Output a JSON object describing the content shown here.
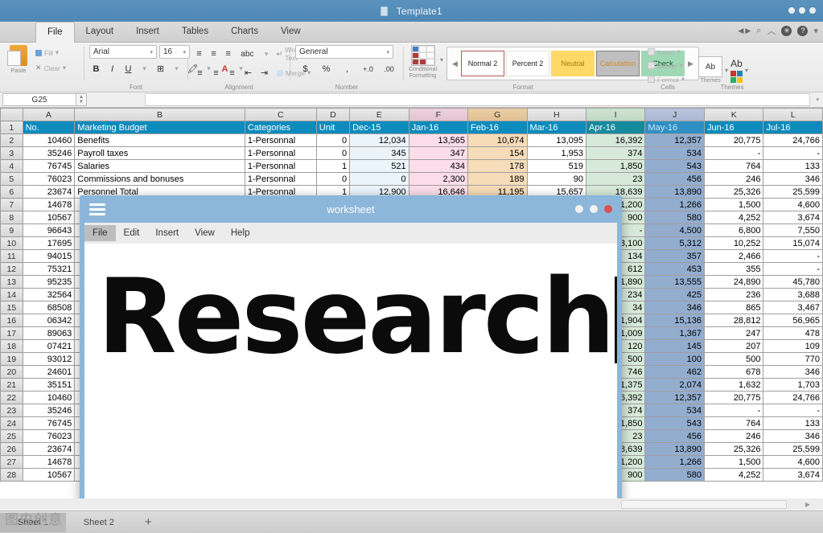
{
  "window": {
    "title": "Template1",
    "doc_icon": "document-icon",
    "controls": [
      "minimize",
      "maximize",
      "close"
    ]
  },
  "ribbon": {
    "tabs": [
      {
        "label": "File",
        "active": true
      },
      {
        "label": "Layout",
        "active": false
      },
      {
        "label": "Insert",
        "active": false
      },
      {
        "label": "Tables",
        "active": false
      },
      {
        "label": "Charts",
        "active": false
      },
      {
        "label": "View",
        "active": false
      }
    ],
    "right_icons": [
      "prev-arrow-icon",
      "next-arrow-icon",
      "search-icon",
      "chevron-up-icon",
      "gear-icon",
      "help-icon",
      "chevron-down-icon"
    ],
    "groups": [
      {
        "name": "Font"
      },
      {
        "name": "Alignment"
      },
      {
        "name": "Number"
      },
      {
        "name": "Format"
      },
      {
        "name": "Cells"
      },
      {
        "name": "Themes"
      }
    ],
    "clipboard": {
      "paste_label": "Paste",
      "fill_label": "Fill",
      "clear_label": "Clear"
    },
    "font": {
      "family": "Arial",
      "size": "16",
      "grow_label": "A",
      "shrink_label": "A",
      "bold": "B",
      "italic": "I",
      "underline": "U"
    },
    "alignment": {
      "orientation_label": "abc",
      "wrap_text_label": "Wrap Text",
      "merge_label": "Merge"
    },
    "number": {
      "format": "General",
      "currency": "$",
      "percent": "%",
      "comma": ",",
      "inc_dec": "+.0",
      "dec_dec": ".00"
    },
    "conditional_formatting_label": "Conditional Formatting",
    "styles": [
      {
        "label": "Normal 2",
        "style": "chip-normal"
      },
      {
        "label": "Percent 2",
        "style": "chip-percent"
      },
      {
        "label": "Neutral",
        "style": "chip-neutral"
      },
      {
        "label": "Calculation",
        "style": "chip-calc"
      },
      {
        "label": "Check",
        "style": "chip-check"
      }
    ],
    "cells": {
      "insert_label": "Insert",
      "delete_label": "Delete",
      "format_label": "Format"
    },
    "themes": {
      "themes_label": "Themes",
      "aa_label": "Ab",
      "ab_label": "Ab"
    }
  },
  "formula_bar": {
    "name_box": "G25",
    "formula_value": ""
  },
  "sheet": {
    "column_letters": [
      "A",
      "B",
      "C",
      "D",
      "E",
      "F",
      "G",
      "H",
      "I",
      "J",
      "K",
      "L"
    ],
    "header_row": [
      "No.",
      "Marketing Budget",
      "Categories",
      "Unit",
      "Dec-15",
      "Jan-16",
      "Feb-16",
      "Mar-16",
      "Apr-16",
      "May-16",
      "Jun-16",
      "Jul-16"
    ],
    "rows": [
      {
        "n": 1,
        "cells": [
          "No.",
          "Marketing Budget",
          "Categories",
          "Unit",
          "Dec-15",
          "Jan-16",
          "Feb-16",
          "Mar-16",
          "Apr-16",
          "May-16",
          "Jun-16",
          "Jul-16"
        ],
        "header": true
      },
      {
        "n": 2,
        "cells": [
          "10460",
          "Benefits",
          "1-Personnal",
          "0",
          "12,034",
          "13,565",
          "10,674",
          "13,095",
          "16,392",
          "12,357",
          "20,775",
          "24,766"
        ]
      },
      {
        "n": 3,
        "cells": [
          "35246",
          "Payroll taxes",
          "1-Personnal",
          "0",
          "345",
          "347",
          "154",
          "1,953",
          "374",
          "534",
          "-",
          "-"
        ]
      },
      {
        "n": 4,
        "cells": [
          "76745",
          "Salaries",
          "1-Personnal",
          "1",
          "521",
          "434",
          "178",
          "519",
          "1,850",
          "543",
          "764",
          "133"
        ]
      },
      {
        "n": 5,
        "cells": [
          "76023",
          "Commissions and bonuses",
          "1-Personnal",
          "0",
          "0",
          "2,300",
          "189",
          "90",
          "23",
          "456",
          "246",
          "346"
        ]
      },
      {
        "n": 6,
        "cells": [
          "23674",
          "Personnel Total",
          "1-Personnal",
          "1",
          "12,900",
          "16,646",
          "11,195",
          "15,657",
          "18,639",
          "13,890",
          "25,326",
          "25,599"
        ]
      },
      {
        "n": 7,
        "cells": [
          "14678",
          "",
          "",
          "",
          "",
          "",
          "",
          "",
          "1,200",
          "1,266",
          "1,500",
          "4,600"
        ]
      },
      {
        "n": 8,
        "cells": [
          "10567",
          "",
          "",
          "",
          "",
          "",
          "",
          "",
          "900",
          "580",
          "4,252",
          "3,674"
        ]
      },
      {
        "n": 9,
        "cells": [
          "96643",
          "",
          "",
          "",
          "",
          "",
          "",
          "",
          "-",
          "4,500",
          "6,800",
          "7,550"
        ]
      },
      {
        "n": 10,
        "cells": [
          "17695",
          "",
          "",
          "",
          "",
          "",
          "",
          "",
          "3,100",
          "5,312",
          "10,252",
          "15,074"
        ]
      },
      {
        "n": 11,
        "cells": [
          "94015",
          "",
          "",
          "",
          "",
          "",
          "",
          "",
          "134",
          "357",
          "2,466",
          "-"
        ]
      },
      {
        "n": 12,
        "cells": [
          "75321",
          "",
          "",
          "",
          "",
          "",
          "",
          "",
          "612",
          "453",
          "355",
          "-"
        ]
      },
      {
        "n": 13,
        "cells": [
          "95235",
          "",
          "",
          "",
          "",
          "",
          "",
          "",
          "1,890",
          "13,555",
          "24,890",
          "45,780"
        ]
      },
      {
        "n": 14,
        "cells": [
          "32564",
          "",
          "",
          "",
          "",
          "",
          "",
          "",
          "234",
          "425",
          "236",
          "3,688"
        ]
      },
      {
        "n": 15,
        "cells": [
          "68508",
          "",
          "",
          "",
          "",
          "",
          "",
          "",
          "34",
          "346",
          "865",
          "3,467"
        ]
      },
      {
        "n": 16,
        "cells": [
          "06342",
          "",
          "",
          "",
          "",
          "",
          "",
          "",
          "1,904",
          "15,136",
          "28,812",
          "56,965"
        ]
      },
      {
        "n": 17,
        "cells": [
          "89063",
          "",
          "",
          "",
          "",
          "",
          "",
          "",
          "1,009",
          "1,367",
          "247",
          "478"
        ]
      },
      {
        "n": 18,
        "cells": [
          "07421",
          "",
          "",
          "",
          "",
          "",
          "",
          "",
          "120",
          "145",
          "207",
          "109"
        ]
      },
      {
        "n": 19,
        "cells": [
          "93012",
          "",
          "",
          "",
          "",
          "",
          "",
          "",
          "500",
          "100",
          "500",
          "770"
        ]
      },
      {
        "n": 20,
        "cells": [
          "24601",
          "",
          "",
          "",
          "",
          "",
          "",
          "",
          "746",
          "462",
          "678",
          "346"
        ]
      },
      {
        "n": 21,
        "cells": [
          "35151",
          "",
          "",
          "",
          "",
          "",
          "",
          "",
          "1,375",
          "2,074",
          "1,632",
          "1,703"
        ]
      },
      {
        "n": 22,
        "cells": [
          "10460",
          "",
          "",
          "",
          "",
          "",
          "",
          "",
          "16,392",
          "12,357",
          "20,775",
          "24,766"
        ]
      },
      {
        "n": 23,
        "cells": [
          "35246",
          "",
          "",
          "",
          "",
          "",
          "",
          "",
          "374",
          "534",
          "-",
          "-"
        ]
      },
      {
        "n": 24,
        "cells": [
          "76745",
          "",
          "",
          "",
          "",
          "",
          "",
          "",
          "1,850",
          "543",
          "764",
          "133"
        ]
      },
      {
        "n": 25,
        "cells": [
          "76023",
          "",
          "",
          "",
          "",
          "",
          "",
          "",
          "23",
          "456",
          "246",
          "346"
        ]
      },
      {
        "n": 26,
        "cells": [
          "23674",
          "",
          "",
          "",
          "",
          "",
          "",
          "",
          "18,639",
          "13,890",
          "25,326",
          "25,599"
        ]
      },
      {
        "n": 27,
        "cells": [
          "14678",
          "",
          "",
          "",
          "",
          "",
          "",
          "",
          "1,200",
          "1,266",
          "1,500",
          "4,600"
        ]
      },
      {
        "n": 28,
        "cells": [
          "10567",
          "",
          "",
          "",
          "",
          "",
          "",
          "",
          "900",
          "580",
          "4,252",
          "3,674"
        ]
      }
    ]
  },
  "overlay": {
    "title": "worksheet",
    "burger_icon": "hamburger-menu-icon",
    "menu": [
      {
        "label": "File",
        "active": true
      },
      {
        "label": "Edit",
        "active": false
      },
      {
        "label": "Insert",
        "active": false
      },
      {
        "label": "View",
        "active": false
      },
      {
        "label": "Help",
        "active": false
      }
    ],
    "content_text": "Research",
    "controls": [
      "minimize",
      "maximize",
      "close"
    ]
  },
  "bottom": {
    "sheets": [
      {
        "label": "Sheet 1",
        "active": true
      },
      {
        "label": "Sheet 2",
        "active": false
      }
    ],
    "add_sheet_label": "+",
    "watermark": "图虫创意"
  },
  "colors": {
    "title_bar": "#4f88b4",
    "header_row": "#0d8bbd",
    "overlay_frame": "#8cb7da",
    "col_f_tint": "#fadde8",
    "col_g_tint": "#f6dcb8",
    "col_i_tint": "#d7ead9",
    "col_j_tint": "#93adcf",
    "close_button": "#d95450"
  }
}
